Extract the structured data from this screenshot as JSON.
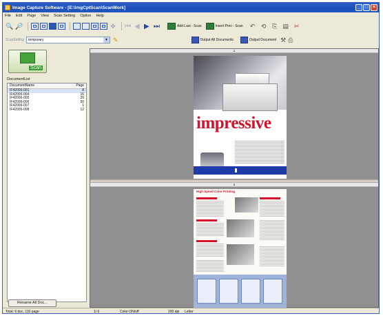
{
  "window": {
    "title": "Image Capture Software - [E:\\ImgCptScan\\ScanWork]",
    "controls": {
      "minimize": "_",
      "maximize": "□",
      "close": "×"
    }
  },
  "menu": [
    "File",
    "Edit",
    "Page",
    "View",
    "Scan Setting",
    "Option",
    "Help"
  ],
  "toolbar": {
    "zoom_in_icon": "🔍",
    "zoom_out_icon": "🔍",
    "add_last_scan_label": "Add Last - Scan",
    "insert_prev_scan_label": "Insert Prev - Scan"
  },
  "toolbar2": {
    "scan_setting_label": "ScanSetting",
    "scan_setting_value": "temporary",
    "output_all_label": "Output All Documents",
    "output_doc_label": "Output Document"
  },
  "left_panel": {
    "scan_button_label": "Scan",
    "doclist_title": "DocumentList",
    "columns": [
      "DocumentName",
      "Page"
    ],
    "rows": [
      {
        "name": "IF42006-001",
        "pages": "8"
      },
      {
        "name": "IF42006-004",
        "pages": "16"
      },
      {
        "name": "IF42006-005",
        "pages": "20"
      },
      {
        "name": "IF42006-006",
        "pages": "50"
      },
      {
        "name": "IF42006-007",
        "pages": "1"
      },
      {
        "name": "IF42006-008",
        "pages": "12"
      }
    ],
    "rename_button_label": "Rename All Doc..."
  },
  "preview": {
    "pane1_label": "1",
    "pane2_label": "2",
    "page1": {
      "headline": "impressive"
    },
    "page2": {
      "headline": "High Speed Color Printing"
    }
  },
  "status": {
    "totals": "Total:   6 doc, 110 page",
    "page": "1/   6",
    "color": "Color:ON/off",
    "dpi": "200 dpi",
    "paper": "Letter"
  }
}
